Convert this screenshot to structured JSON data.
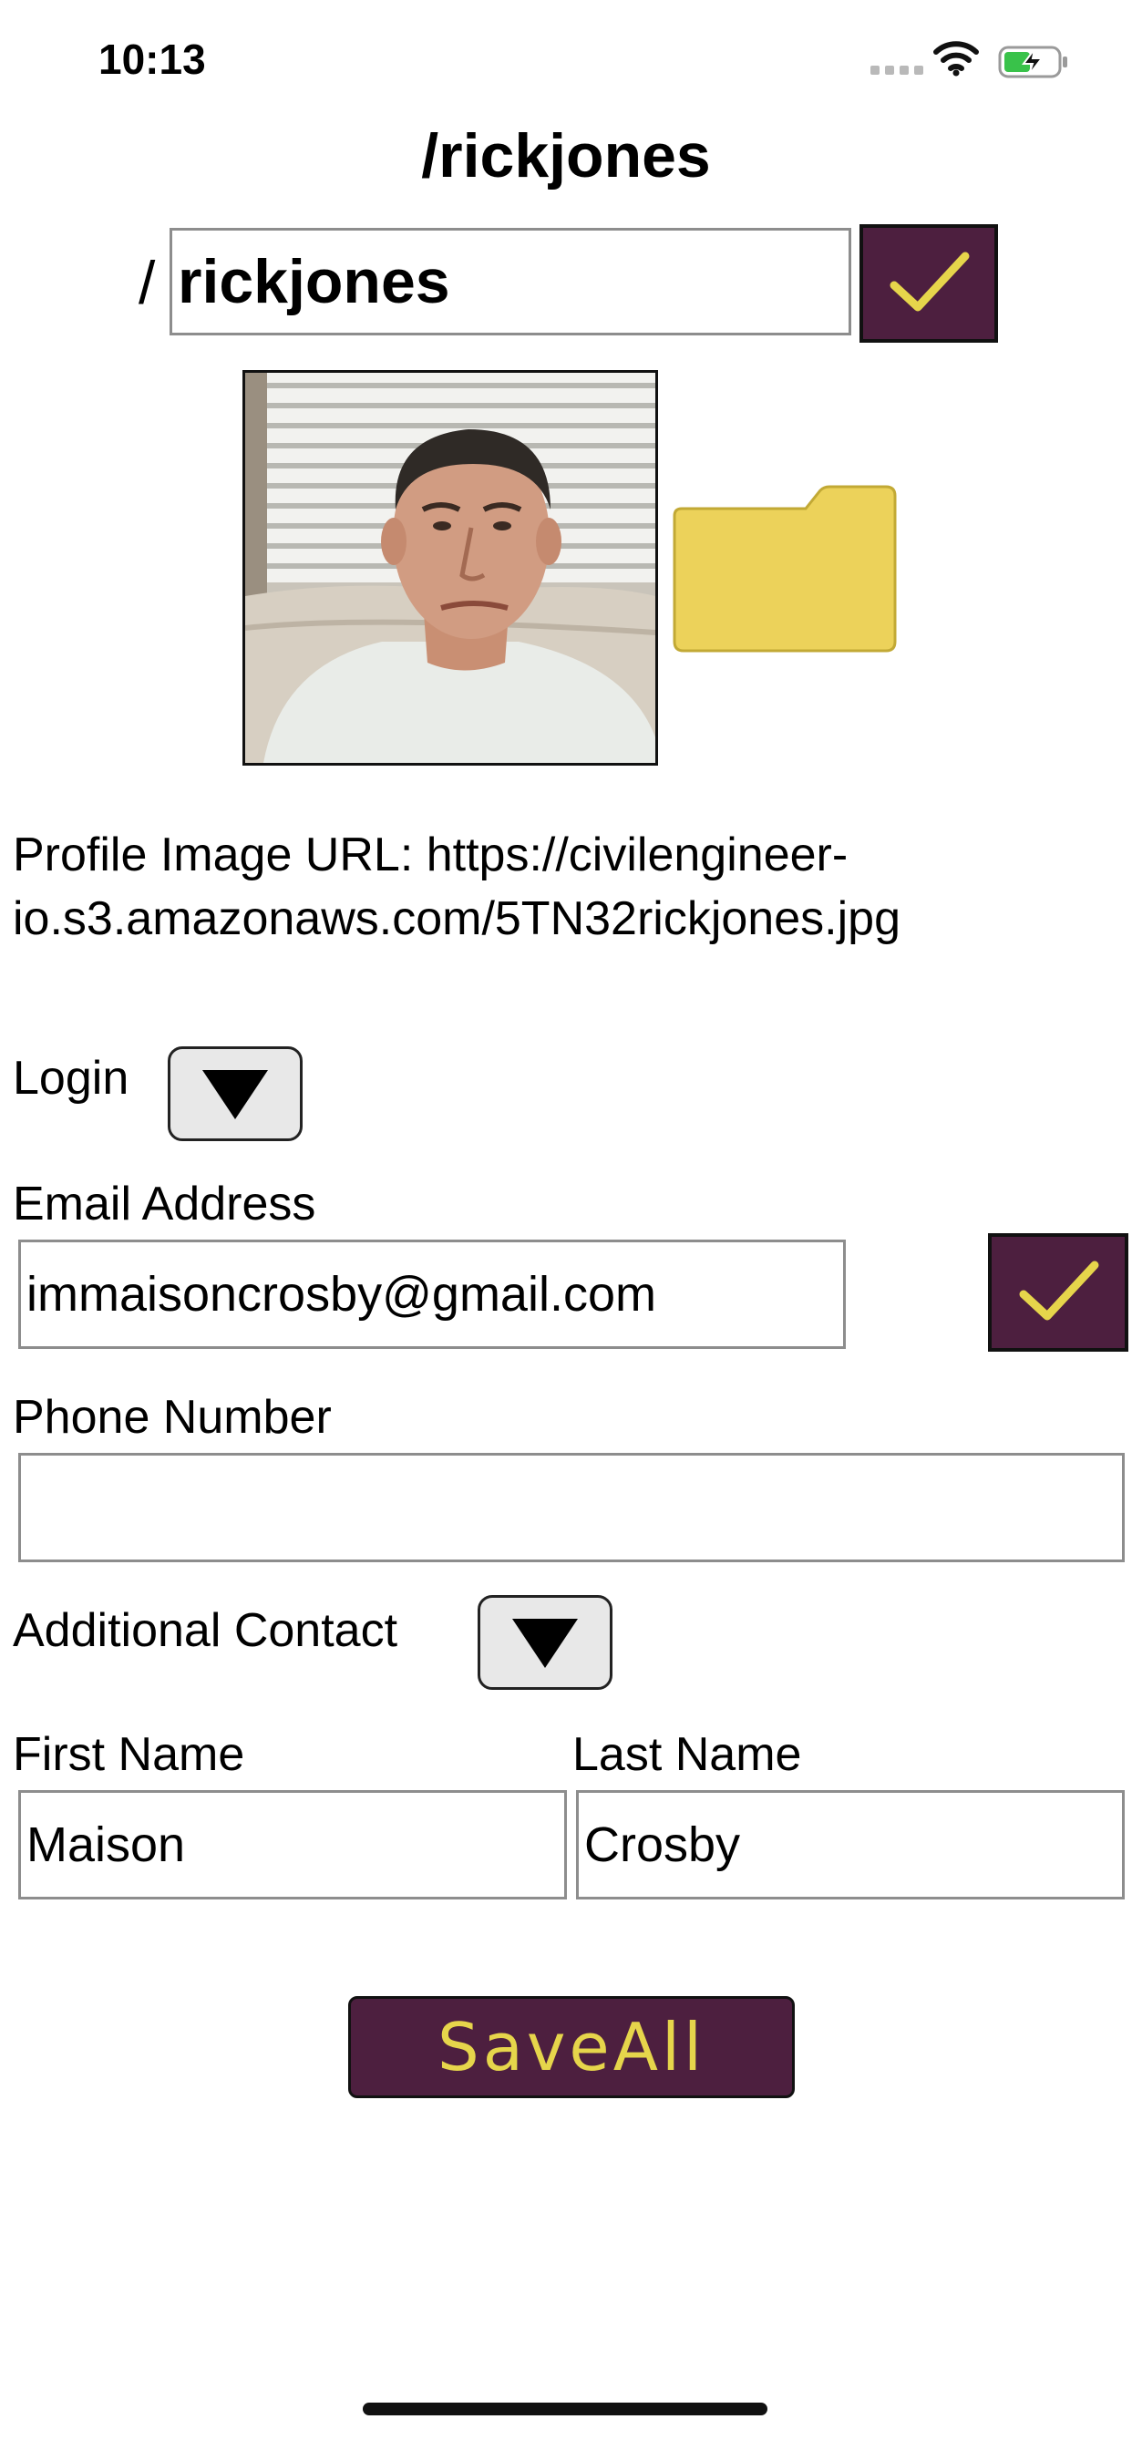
{
  "status_bar": {
    "time": "10:13"
  },
  "header": {
    "title": "/rickjones",
    "slash_prefix": "/",
    "username_value": "rickjones"
  },
  "profile": {
    "image_url_label": "Profile Image URL: https://civilengineer-io.s3.amazonaws.com/5TN32rickjones.jpg"
  },
  "login": {
    "label": "Login"
  },
  "email": {
    "label": "Email Address",
    "value": "immaisoncrosby@gmail.com"
  },
  "phone": {
    "label": "Phone Number",
    "value": ""
  },
  "additional_contact": {
    "label": "Additional Contact"
  },
  "name": {
    "first_label": "First Name",
    "first_value": "Maison",
    "last_label": "Last Name",
    "last_value": "Crosby"
  },
  "actions": {
    "save_label": "SaveAll"
  },
  "colors": {
    "accent": "#4d1f3f",
    "check_mark": "#e6d54b",
    "folder": "#ecd25a"
  },
  "icons": [
    "wifi-icon",
    "battery-icon",
    "check-icon",
    "folder-icon",
    "triangle-down-icon"
  ]
}
